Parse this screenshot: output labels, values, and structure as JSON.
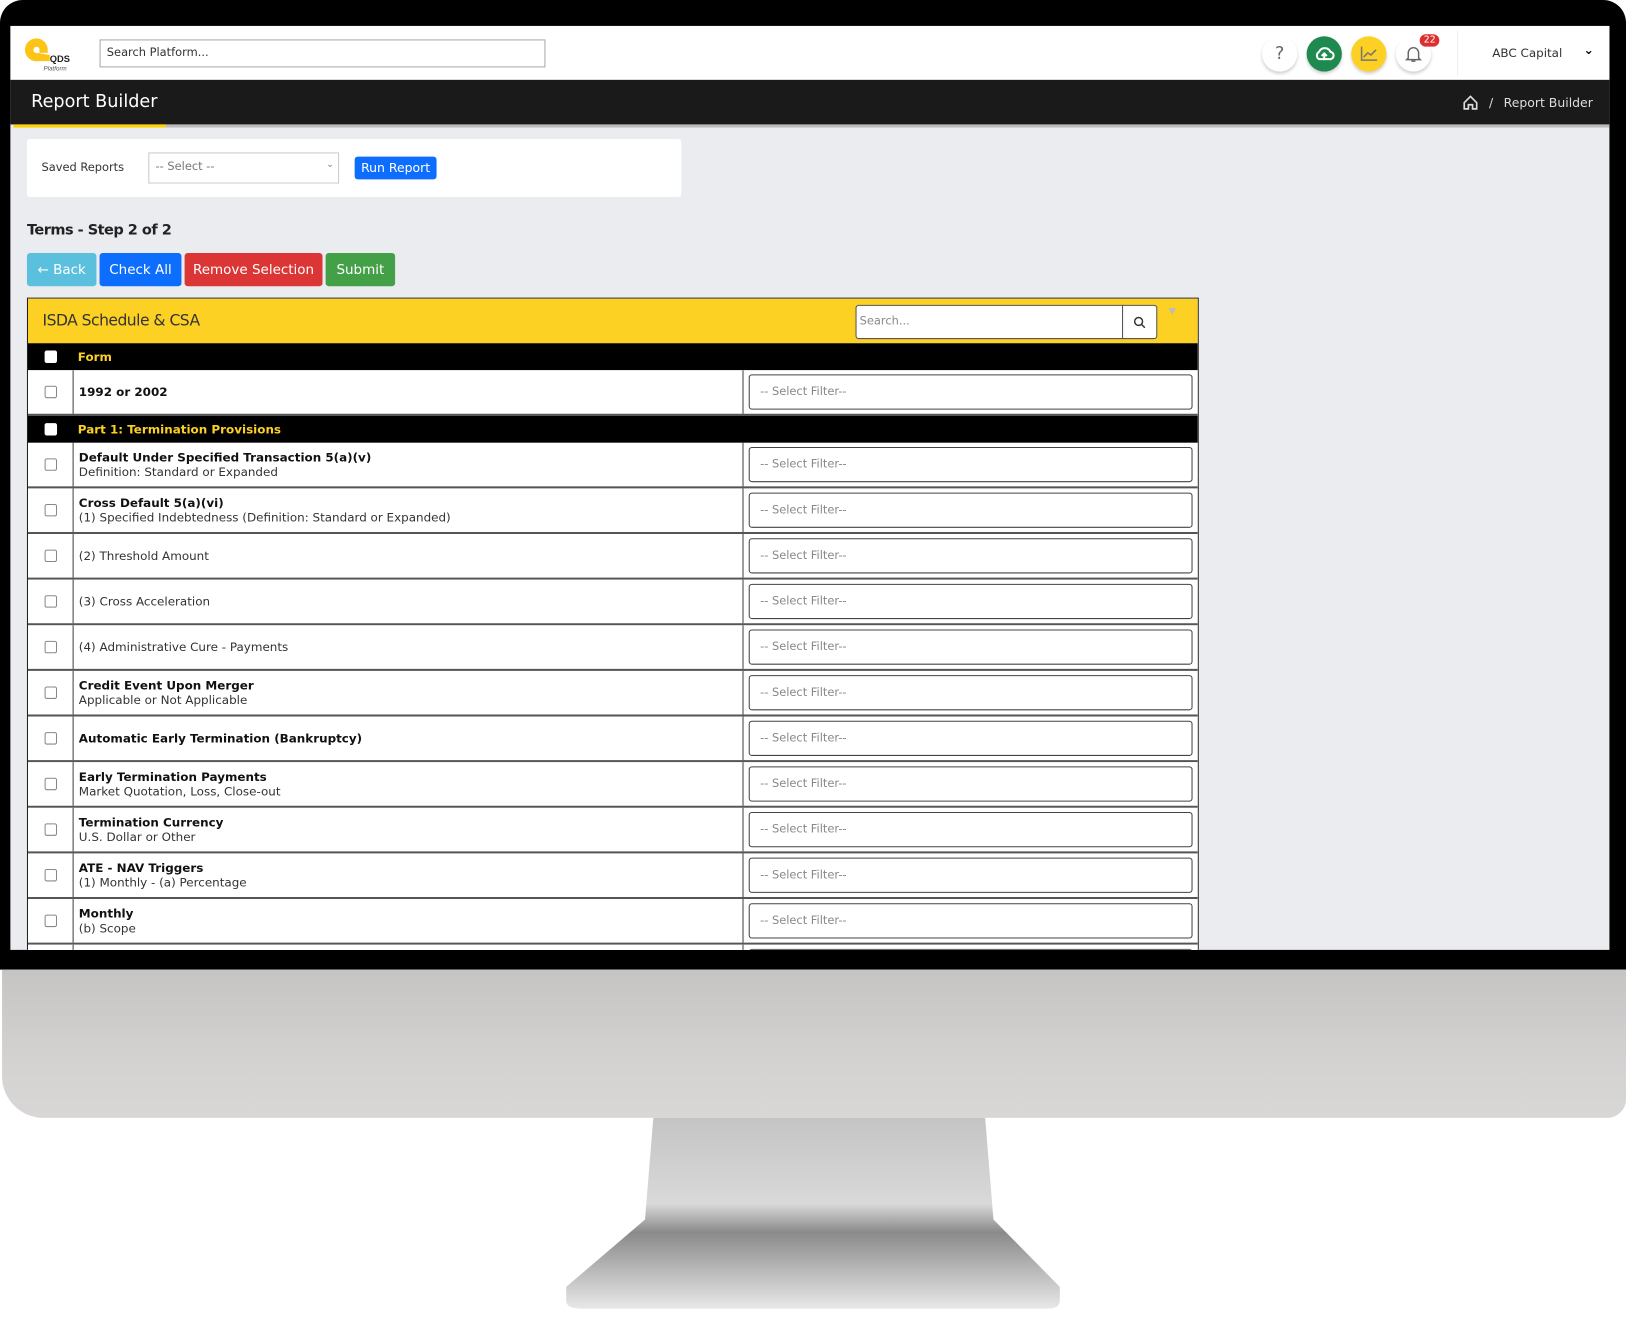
{
  "header": {
    "logo_text": "QDS",
    "logo_sub": "Platform",
    "search_placeholder": "Search Platform...",
    "notification_count": "22",
    "account": "ABC Capital",
    "icons": [
      "help-icon",
      "cloud-upload-icon",
      "chart-line-icon",
      "bell-icon"
    ],
    "colors": {
      "upload": "#1e8a4f",
      "chart": "#fcd123",
      "badge": "#dc2f2f"
    }
  },
  "page": {
    "title": "Report Builder",
    "breadcrumb": "Report Builder"
  },
  "saved": {
    "label": "Saved Reports",
    "select": "-- Select --",
    "run": "Run Report"
  },
  "step": "Terms - Step 2 of 2",
  "actions": {
    "back": "Back",
    "check_all": "Check All",
    "remove": "Remove Selection",
    "submit": "Submit"
  },
  "panel": {
    "title": "ISDA Schedule & CSA",
    "search_placeholder": "Search...",
    "accent": "#fcd123",
    "rows": [
      {
        "group": true,
        "label": "Form"
      },
      {
        "label": "1992 or 2002",
        "sub": "",
        "filter": "-- Select Filter--"
      },
      {
        "group": true,
        "label": "Part 1: Termination Provisions"
      },
      {
        "label": "Default Under Specified Transaction 5(a)(v)",
        "sub": "Definition: Standard or Expanded",
        "filter": "-- Select Filter--"
      },
      {
        "label": "Cross Default 5(a)(vi)",
        "sub": "(1) Specified Indebtedness (Definition: Standard or Expanded)",
        "filter": "-- Select Filter--"
      },
      {
        "label": "",
        "sub": "(2) Threshold Amount",
        "filter": "-- Select Filter--"
      },
      {
        "label": "",
        "sub": "(3) Cross Acceleration",
        "filter": "-- Select Filter--"
      },
      {
        "label": "",
        "sub": "(4) Administrative Cure - Payments",
        "filter": "-- Select Filter--"
      },
      {
        "label": "Credit Event Upon Merger",
        "sub": "Applicable or Not Applicable",
        "filter": "-- Select Filter--"
      },
      {
        "label": "Automatic Early Termination (Bankruptcy)",
        "sub": "",
        "filter": "-- Select Filter--"
      },
      {
        "label": "Early Termination Payments",
        "sub": "Market Quotation, Loss, Close-out",
        "filter": "-- Select Filter--"
      },
      {
        "label": "Termination Currency",
        "sub": "U.S. Dollar or Other",
        "filter": "-- Select Filter--"
      },
      {
        "label": "ATE - NAV Triggers",
        "sub": "(1) Monthly - (a) Percentage",
        "filter": "-- Select Filter--"
      },
      {
        "label": "Monthly",
        "sub": "(b) Scope",
        "filter": "-- Select Filter--"
      },
      {
        "label": "",
        "sub": "",
        "filter": ""
      }
    ]
  }
}
